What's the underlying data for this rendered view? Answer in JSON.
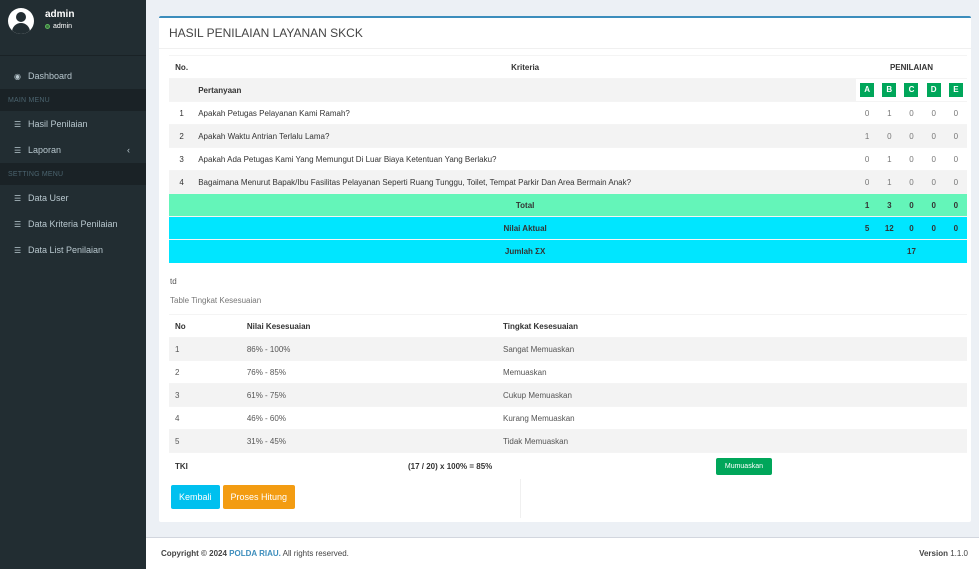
{
  "user": {
    "name": "admin",
    "status": "admin"
  },
  "sidebar": {
    "items": [
      {
        "label": "Dashboard",
        "icon": "dashboard-icon"
      },
      {
        "header": "MAIN MENU"
      },
      {
        "label": "Hasil Penilaian",
        "icon": "list-icon"
      },
      {
        "label": "Laporan",
        "icon": "list-icon"
      },
      {
        "header": "SETTING MENU"
      },
      {
        "label": "Data User",
        "icon": "list-icon"
      },
      {
        "label": "Data Kriteria Penilaian",
        "icon": "list-icon"
      },
      {
        "label": "Data List Penilaian",
        "icon": "list-icon"
      }
    ],
    "caret": "‹"
  },
  "main": {
    "title": "HASIL PENILAIAN LAYANAN SKCK",
    "table1": {
      "col_no": "No.",
      "col_kriteria": "Kriteria",
      "col_penilaian": "PENILAIAN",
      "sub_pertanyaan": "Pertanyaan",
      "grades": [
        "A",
        "B",
        "C",
        "D",
        "E"
      ],
      "rows": [
        {
          "no": "1",
          "q": "Apakah Petugas Pelayanan Kami Ramah?",
          "s": [
            "0",
            "1",
            "0",
            "0",
            "0"
          ]
        },
        {
          "no": "2",
          "q": "Apakah Waktu Antrian Terlalu Lama?",
          "s": [
            "1",
            "0",
            "0",
            "0",
            "0"
          ]
        },
        {
          "no": "3",
          "q": "Apakah Ada Petugas Kami Yang Memungut Di Luar Biaya Ketentuan Yang Berlaku?",
          "s": [
            "0",
            "1",
            "0",
            "0",
            "0"
          ]
        },
        {
          "no": "4",
          "q": "Bagaimana Menurut Bapak/Ibu Fasilitas Pelayanan Seperti Ruang Tunggu, Toilet, Tempat Parkir Dan Area Bermain Anak?",
          "s": [
            "0",
            "1",
            "0",
            "0",
            "0"
          ]
        }
      ],
      "total_label": "Total",
      "total": [
        "1",
        "3",
        "0",
        "0",
        "0"
      ],
      "aktual_label": "Nilai Aktual",
      "aktual": [
        "5",
        "12",
        "0",
        "0",
        "0"
      ],
      "jumlah_label": "Jumlah ΣX",
      "jumlah": "17"
    },
    "td_text": "td",
    "table2_caption": "Table Tingkat Kesesuaian",
    "table2": {
      "headers": [
        "No",
        "Nilai Kesesuaian",
        "Tingkat Kesesuaian"
      ],
      "rows": [
        [
          "1",
          "86% - 100%",
          "Sangat Memuaskan"
        ],
        [
          "2",
          "76% - 85%",
          "Memuaskan"
        ],
        [
          "3",
          "61% - 75%",
          "Cukup Memuaskan"
        ],
        [
          "4",
          "46% - 60%",
          "Kurang Memuaskan"
        ],
        [
          "5",
          "31% - 45%",
          "Tidak Memuaskan"
        ]
      ],
      "tki_label": "TKI",
      "tki_formula": "(17 / 20) x 100% = 85%",
      "tki_badge": "Mumuaskan"
    },
    "buttons": {
      "back": "Kembali",
      "process": "Proses Hitung"
    }
  },
  "footer": {
    "copyright_prefix": "Copyright © 2024",
    "org": "POLDA RIAU.",
    "rights": "All rights reserved.",
    "version_label": "Version",
    "version": "1.1.0"
  },
  "colors": {
    "sidebar": "#222d32",
    "accent": "#3c8dbc",
    "green": "#00a65a",
    "mint": "#64f5b9",
    "cyan": "#00e6ff",
    "info": "#00c0ef",
    "warning": "#f39c12"
  }
}
